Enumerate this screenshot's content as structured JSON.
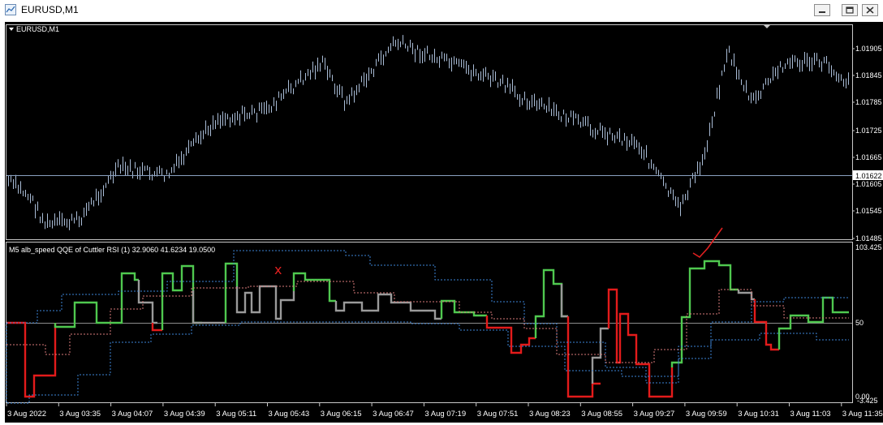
{
  "window": {
    "title": "EURUSD,M1",
    "buttons": [
      "minimize",
      "restore",
      "close"
    ]
  },
  "main_chart": {
    "label": "EURUSD,M1",
    "price_ticks": [
      "1.01905",
      "1.01845",
      "1.01785",
      "1.01725",
      "1.01665",
      "1.01605",
      "1.01545",
      "1.01485"
    ],
    "current_price": "1.01622",
    "bar_color": "#a9bcd6"
  },
  "indicator": {
    "label": "M5 alb_speed QQE of Cuttler RSI (1) 32.9060 41.6234 19.0500",
    "scale_top": "103.425",
    "level_mid": "50",
    "scale_bottom": "0.00",
    "scale_bottom2": "-3.425",
    "annotation_cross": "x",
    "annotation_check": "✓"
  },
  "time_axis": [
    "3 Aug 2022",
    "3 Aug 03:35",
    "3 Aug 04:07",
    "3 Aug 04:39",
    "3 Aug 05:11",
    "3 Aug 05:43",
    "3 Aug 06:15",
    "3 Aug 06:47",
    "3 Aug 07:19",
    "3 Aug 07:51",
    "3 Aug 08:23",
    "3 Aug 08:55",
    "3 Aug 09:27",
    "3 Aug 09:59",
    "3 Aug 10:31",
    "3 Aug 11:03",
    "3 Aug 11:35"
  ],
  "colors": {
    "background": "#000000",
    "rsi_up": "#4fc84f",
    "rsi_down": "#e31b1b",
    "rsi_neutral": "#9a9a9a",
    "band_blue": "#3d85d6",
    "band_pink": "#d87a7a",
    "axis_text": "#ffffff"
  }
}
